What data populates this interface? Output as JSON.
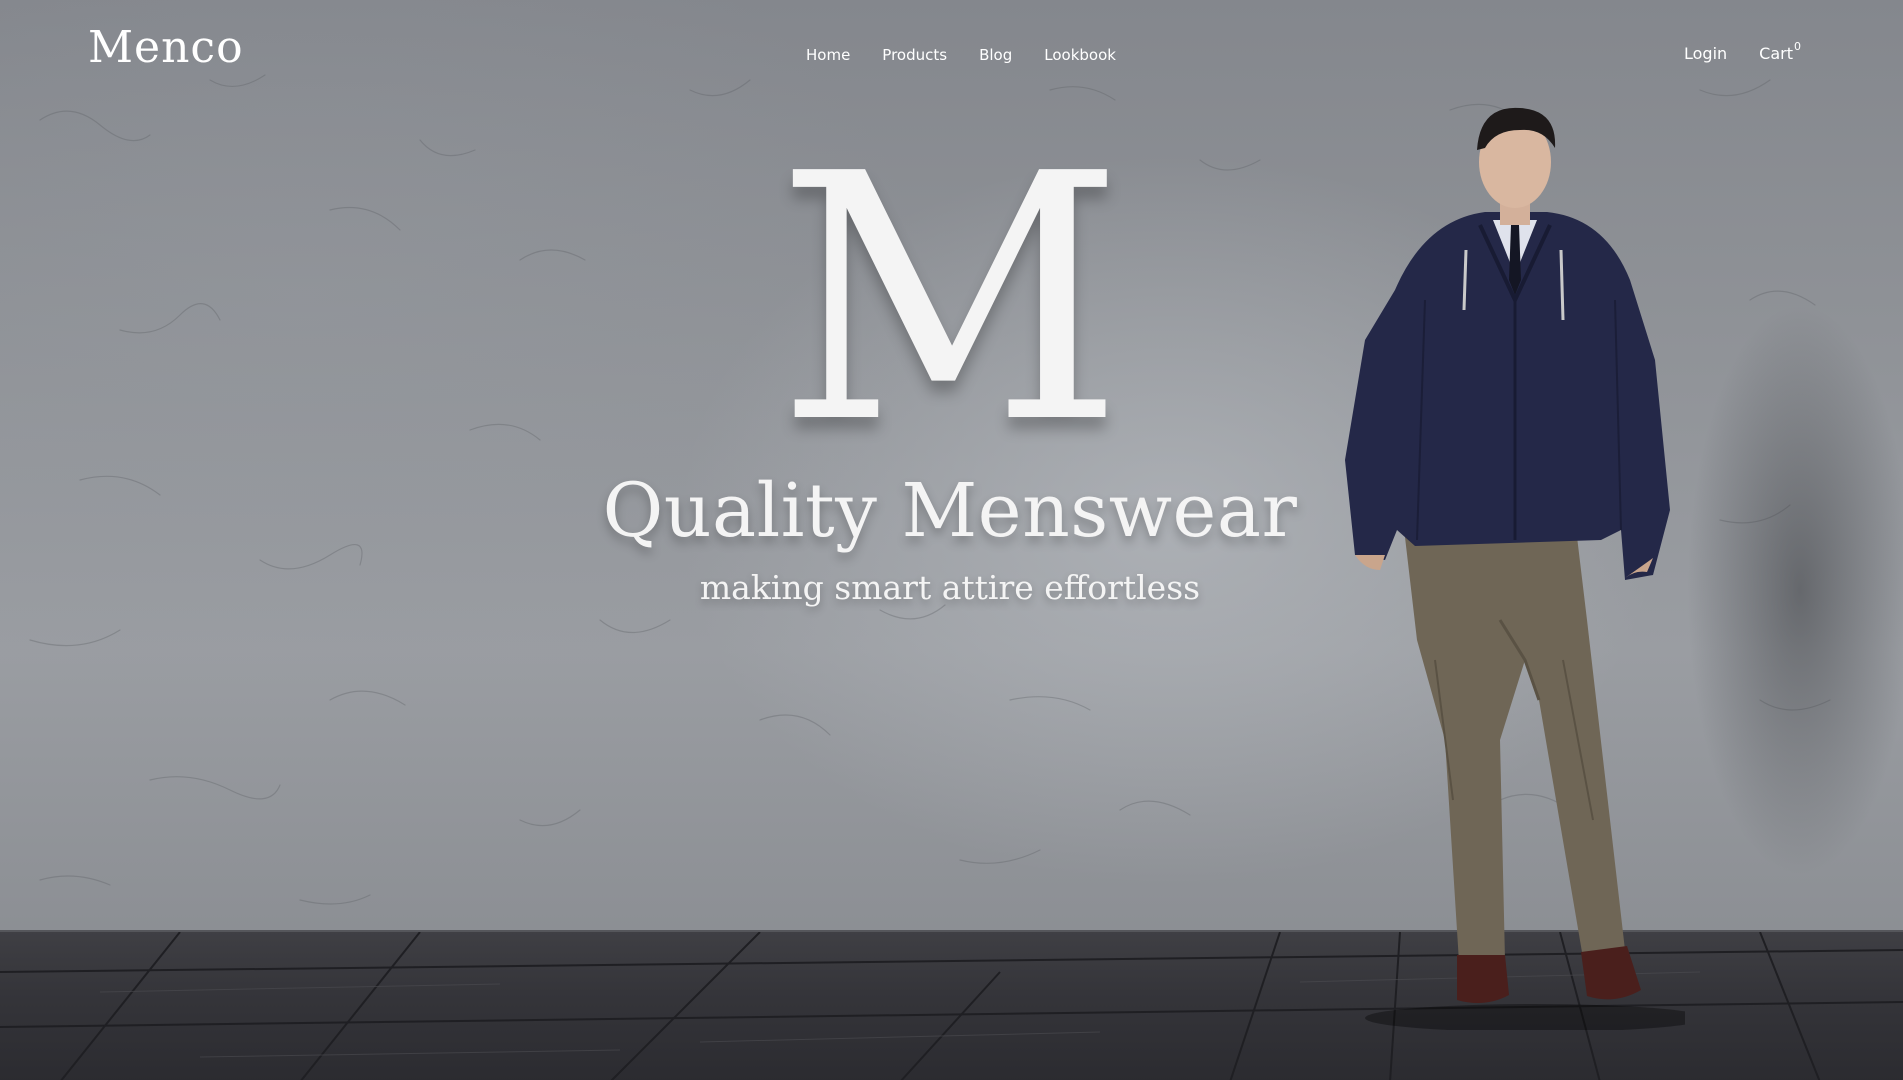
{
  "header": {
    "logo": "Menco",
    "nav": [
      {
        "label": "Home"
      },
      {
        "label": "Products"
      },
      {
        "label": "Blog"
      },
      {
        "label": "Lookbook"
      }
    ],
    "login_label": "Login",
    "cart_label": "Cart",
    "cart_count": "0"
  },
  "hero": {
    "monogram": "M",
    "headline": "Quality Menswear",
    "tagline": "making smart attire effortless"
  },
  "colors": {
    "wall": "#8f9297",
    "floor": "#35353a",
    "text": "#f4f4f4",
    "jacket": "#242848",
    "trousers": "#6f6656",
    "shoes": "#4a1f1c"
  },
  "icons": {
    "cart": "cart-text-link"
  }
}
